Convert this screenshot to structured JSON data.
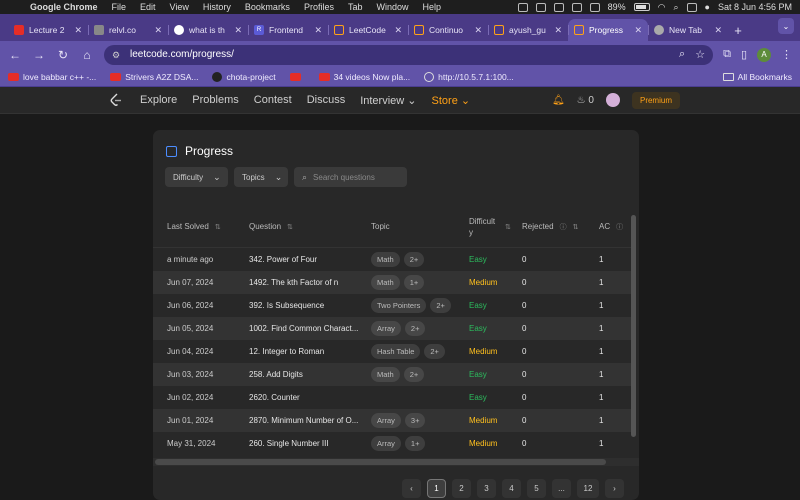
{
  "menubar": {
    "app": "Google Chrome",
    "items": [
      "File",
      "Edit",
      "View",
      "History",
      "Bookmarks",
      "Profiles",
      "Tab",
      "Window",
      "Help"
    ],
    "battery": "89%",
    "datetime": "Sat 8 Jun  4:56 PM"
  },
  "tabs": [
    {
      "title": "Lecture 2",
      "fav_color": "#e52d27",
      "active": false
    },
    {
      "title": "relvl.co",
      "fav_color": "#888888",
      "active": false
    },
    {
      "title": "what is th",
      "fav_color": "#ffffff",
      "active": false
    },
    {
      "title": "Frontend",
      "fav_color": "#5b5bd6",
      "active": false
    },
    {
      "title": "LeetCode",
      "fav_color": "#ffa116",
      "active": false
    },
    {
      "title": "Continuo",
      "fav_color": "#ffa116",
      "active": false
    },
    {
      "title": "ayush_gu",
      "fav_color": "#ffa116",
      "active": false
    },
    {
      "title": "Progress",
      "fav_color": "#ffa116",
      "active": true
    },
    {
      "title": "New Tab",
      "fav_color": "#aaaaaa",
      "active": false
    }
  ],
  "address": {
    "url": "leetcode.com/progress/"
  },
  "profile_initial": "A",
  "bookmarks": [
    {
      "label": "love babbar c++ -...",
      "icon": "yt"
    },
    {
      "label": "Strivers A2Z DSA...",
      "icon": "yt"
    },
    {
      "label": "chota-project",
      "icon": "gh"
    },
    {
      "label": "",
      "icon": "yt"
    },
    {
      "label": "34 videos Now pla...",
      "icon": "yt"
    },
    {
      "label": "http://10.5.7.1:100...",
      "icon": "globe"
    }
  ],
  "all_bookmarks": "All Bookmarks",
  "lcnav": {
    "items": [
      "Explore",
      "Problems",
      "Contest",
      "Discuss"
    ],
    "interview": "Interview",
    "store": "Store",
    "streak": "0",
    "premium": "Premium"
  },
  "panel": {
    "title": "Progress",
    "filter_difficulty": "Difficulty",
    "filter_topics": "Topics",
    "search_placeholder": "Search questions"
  },
  "table": {
    "headers": {
      "last_solved": "Last Solved",
      "question": "Question",
      "topic": "Topic",
      "difficulty": "Difficult y",
      "rejected": "Rejected",
      "ac": "AC"
    },
    "rows": [
      {
        "date": "a minute ago",
        "question": "342. Power of Four",
        "topic": "Math",
        "more": "2+",
        "difficulty": "Easy",
        "rejected": "0",
        "ac": "1"
      },
      {
        "date": "Jun 07, 2024",
        "question": "1492. The kth Factor of n",
        "topic": "Math",
        "more": "1+",
        "difficulty": "Medium",
        "rejected": "0",
        "ac": "1"
      },
      {
        "date": "Jun 06, 2024",
        "question": "392. Is Subsequence",
        "topic": "Two Pointers",
        "more": "2+",
        "difficulty": "Easy",
        "rejected": "0",
        "ac": "1"
      },
      {
        "date": "Jun 05, 2024",
        "question": "1002. Find Common Charact...",
        "topic": "Array",
        "more": "2+",
        "difficulty": "Easy",
        "rejected": "0",
        "ac": "1"
      },
      {
        "date": "Jun 04, 2024",
        "question": "12. Integer to Roman",
        "topic": "Hash Table",
        "more": "2+",
        "difficulty": "Medium",
        "rejected": "0",
        "ac": "1"
      },
      {
        "date": "Jun 03, 2024",
        "question": "258. Add Digits",
        "topic": "Math",
        "more": "2+",
        "difficulty": "Easy",
        "rejected": "0",
        "ac": "1"
      },
      {
        "date": "Jun 02, 2024",
        "question": "2620. Counter",
        "topic": "",
        "more": "",
        "difficulty": "Easy",
        "rejected": "0",
        "ac": "1"
      },
      {
        "date": "Jun 01, 2024",
        "question": "2870. Minimum Number of O...",
        "topic": "Array",
        "more": "3+",
        "difficulty": "Medium",
        "rejected": "0",
        "ac": "1"
      },
      {
        "date": "May 31, 2024",
        "question": "260. Single Number III",
        "topic": "Array",
        "more": "1+",
        "difficulty": "Medium",
        "rejected": "0",
        "ac": "1"
      }
    ]
  },
  "pagination": {
    "pages": [
      "1",
      "2",
      "3",
      "4",
      "5",
      "...",
      "12"
    ],
    "current": "1",
    "prev": "‹",
    "next": "›"
  },
  "colors": {
    "easy": "#2cbb5d",
    "medium": "#ffc01e",
    "brand": "#ffa116",
    "chrome_theme": "#6153a8"
  }
}
